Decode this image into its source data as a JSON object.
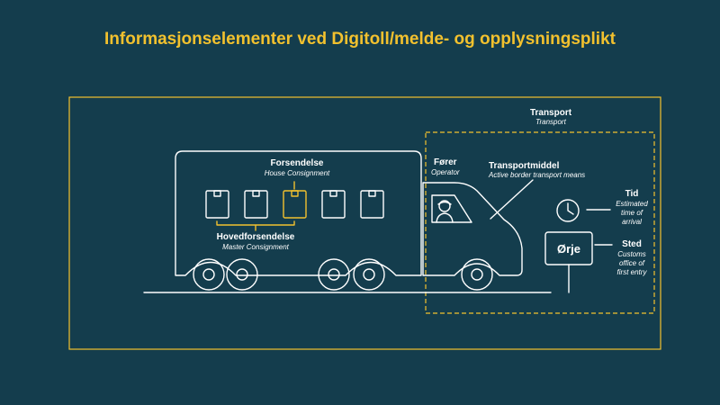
{
  "title": "Informasjonselementer ved Digitoll/melde- og opplysningsplikt",
  "transport": {
    "label": "Transport",
    "sub": "Transport"
  },
  "consignment": {
    "label": "Forsendelse",
    "sub": "House Consignment"
  },
  "master": {
    "label": "Hovedforsendelse",
    "sub": "Master Consignment"
  },
  "operator": {
    "label": "Fører",
    "sub": "Operator"
  },
  "means": {
    "label": "Transportmiddel",
    "sub": "Active border transport means"
  },
  "time": {
    "label": "Tid",
    "sub": [
      "Estimated",
      "time of",
      "arrival"
    ]
  },
  "place": {
    "label": "Sted",
    "sub": [
      "Customs",
      "office of",
      "first entry"
    ],
    "sign": "Ørje"
  },
  "colors": {
    "background": "#143d4d",
    "accent": "#f2c12e",
    "line": "#ffffff"
  }
}
